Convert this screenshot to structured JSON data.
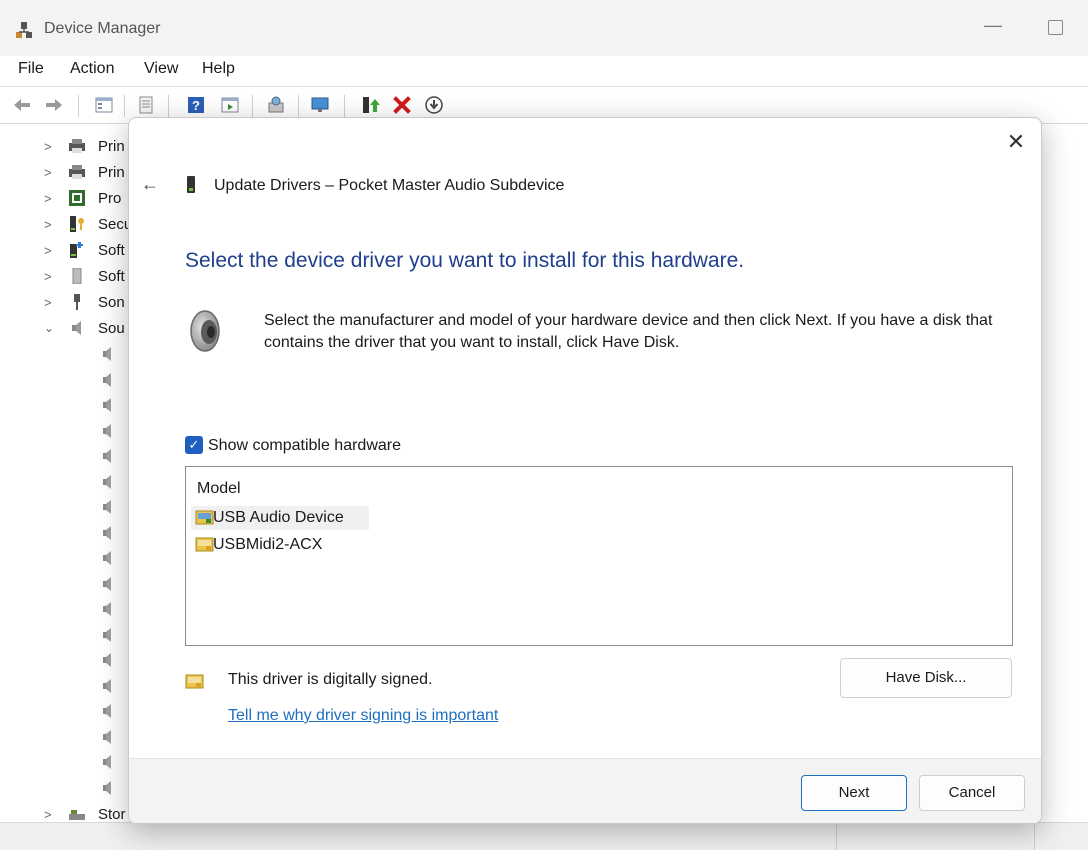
{
  "window": {
    "title": "Device Manager",
    "minimize_glyph": "—"
  },
  "menu": {
    "file": "File",
    "action": "Action",
    "view": "View",
    "help": "Help"
  },
  "tree": {
    "items": [
      {
        "label": "Prin",
        "icon": "printer-icon"
      },
      {
        "label": "Prin",
        "icon": "printer-icon"
      },
      {
        "label": "Pro",
        "icon": "processor-icon"
      },
      {
        "label": "Secu",
        "icon": "security-device-icon"
      },
      {
        "label": "Soft",
        "icon": "software-component-icon"
      },
      {
        "label": "Soft",
        "icon": "software-device-icon"
      },
      {
        "label": "Son",
        "icon": "sound-device-icon"
      },
      {
        "label": "Sou",
        "icon": "speaker-icon"
      },
      {
        "label": "Stor",
        "icon": "storage-icon"
      }
    ]
  },
  "dialog": {
    "close_glyph": "✕",
    "back_glyph": "←",
    "title": "Update Drivers – Pocket Master Audio Subdevice",
    "heading": "Select the device driver you want to install for this hardware.",
    "instructions": "Select the manufacturer and model of your hardware device and then click Next. If you have a disk that contains the driver that you want to install, click Have Disk.",
    "checkbox_label": "Show compatible hardware",
    "checkbox_glyph": "✓",
    "list_header": "Model",
    "models": [
      {
        "label": "USB Audio Device",
        "selected": true
      },
      {
        "label": "USBMidi2-ACX",
        "selected": false
      }
    ],
    "signed_text": "This driver is digitally signed.",
    "signing_link": "Tell me why driver signing is important",
    "have_disk_label": "Have Disk...",
    "next_label": "Next",
    "cancel_label": "Cancel"
  },
  "colors": {
    "heading": "#1f3f8c",
    "link": "#1f6fbf",
    "checkbox": "#1f5fbf",
    "delete_red": "#d11a1a"
  }
}
